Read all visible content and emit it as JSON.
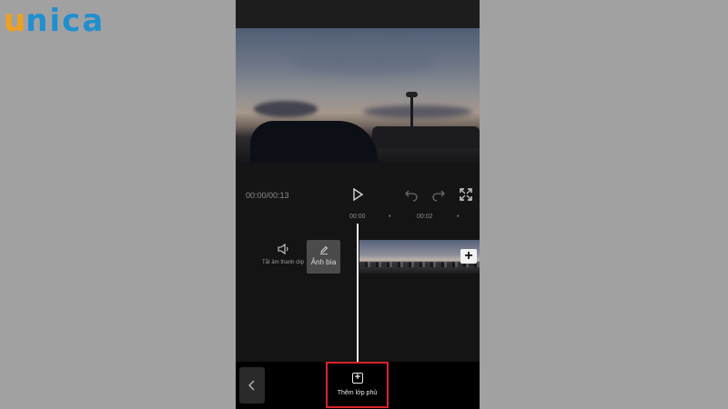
{
  "brand": {
    "logo_first": "u",
    "logo_rest": "nica",
    "colors": {
      "u": "#f0a020",
      "rest": "#1f8fd0"
    }
  },
  "player": {
    "time": "00:00/00:13",
    "icons": [
      "play-icon",
      "undo-icon",
      "redo-icon",
      "fullscreen-icon"
    ]
  },
  "timeline": {
    "ruler": [
      "00:00",
      "•",
      "00:02",
      "•"
    ],
    "mute_label": "Tắt âm thanh clip",
    "cover_label": "Ảnh bìa",
    "add_clip_symbol": "+"
  },
  "bottom": {
    "overlay_label": "Thêm lớp phủ",
    "highlight_color": "#d8232a"
  }
}
